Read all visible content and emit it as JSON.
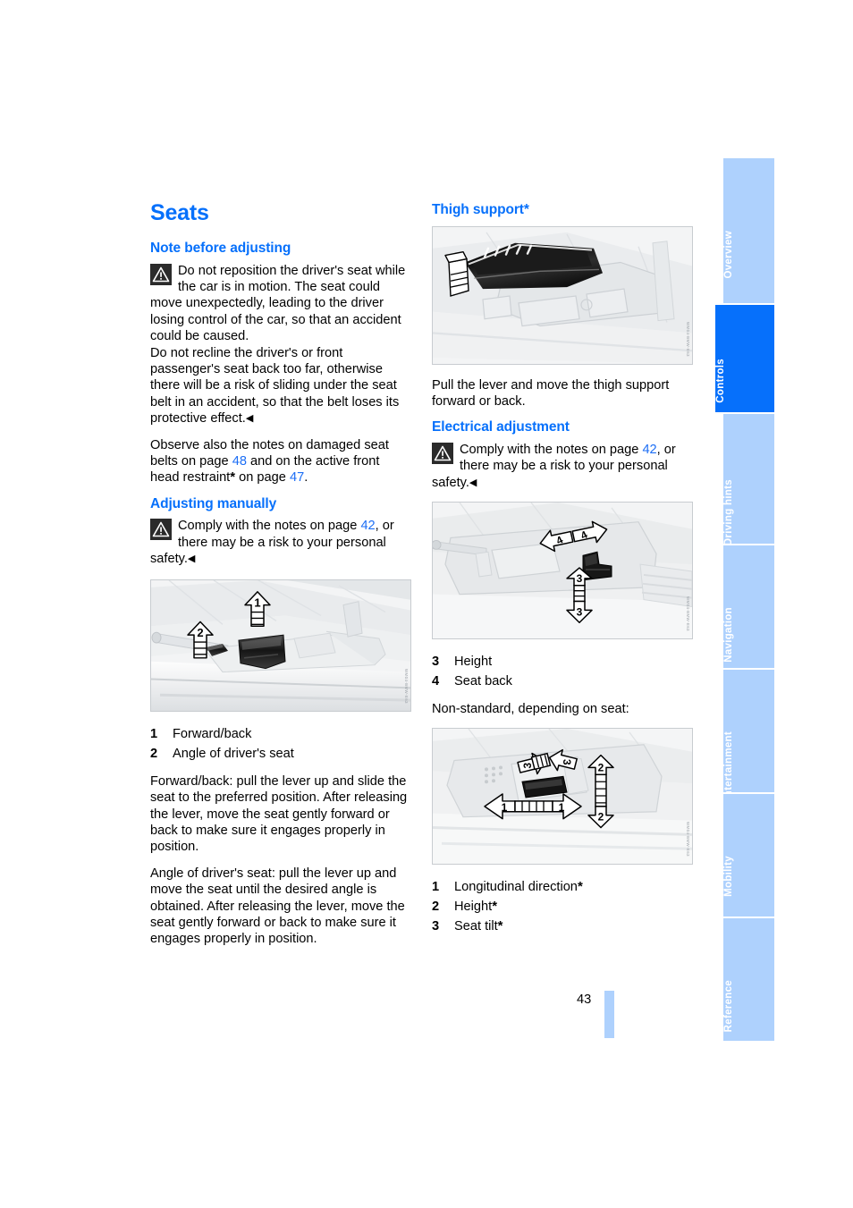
{
  "document": {
    "page_number": "43"
  },
  "left_column": {
    "title": "Seats",
    "section_note": {
      "heading": "Note before adjusting",
      "warning_p1_a": "Do not reposition the driver's seat while the car is in motion. The seat could move unexpectedly, leading to the driver losing control of the car, so that an accident could be caused.",
      "warning_p1_b": "Do not recline the driver's or front passenger's seat back too far, otherwise there will be a risk of sliding under the seat belt in an accident, so that the belt loses its protective effect.",
      "observe_pre": "Observe also the notes on damaged seat belts on page ",
      "observe_ref1": "48",
      "observe_mid": " and on the active front head restraint",
      "observe_mid2": " on page ",
      "observe_ref2": "47",
      "observe_end": "."
    },
    "section_manual": {
      "heading": "Adjusting manually",
      "warning_pre": "Comply with the notes on page ",
      "warning_ref": "42",
      "warning_post": ", or there may be a risk to your personal safety.",
      "legend": [
        {
          "num": "1",
          "label": "Forward/back"
        },
        {
          "num": "2",
          "label": "Angle of driver's seat"
        }
      ],
      "para_forward": "Forward/back: pull the lever up and slide the seat to the preferred position. After releasing the lever, move the seat gently forward or back to make sure it engages properly in position.",
      "para_angle": "Angle of driver's seat: pull the lever up and move the seat until the desired angle is obtained. After releasing the lever, move the seat gently forward or back to make sure it engages properly in position."
    }
  },
  "right_column": {
    "section_thigh": {
      "heading": "Thigh support",
      "heading_asterisk": "*",
      "caption": "Pull the lever and move the thigh support forward or back."
    },
    "section_electrical": {
      "heading": "Electrical adjustment",
      "warning_pre": "Comply with the notes on page ",
      "warning_ref": "42",
      "warning_post": ", or there may be a risk to your personal safety.",
      "legend_primary": [
        {
          "num": "3",
          "label": "Height"
        },
        {
          "num": "4",
          "label": "Seat back"
        }
      ],
      "nonstandard_note": "Non-standard, depending on seat:",
      "legend_secondary": [
        {
          "num": "1",
          "label": "Longitudinal direction",
          "asterisk": "*"
        },
        {
          "num": "2",
          "label": "Height",
          "asterisk": "*"
        },
        {
          "num": "3",
          "label": "Seat tilt",
          "asterisk": "*"
        }
      ]
    }
  },
  "figures": {
    "manual_adjust": {
      "credit": "WM04-BMW-E63",
      "arrow_labels": [
        "1",
        "2"
      ]
    },
    "thigh_support": {
      "credit": "WM04-BMW-E63",
      "arrow_labels": []
    },
    "electrical_adjust": {
      "credit": "WM04-BMW-E63",
      "arrow_labels": [
        "4",
        "4",
        "3",
        "3"
      ]
    },
    "electrical_nonstandard": {
      "credit": "WM04-BMW-E63",
      "arrow_labels": [
        "3",
        "3",
        "2",
        "2",
        "1",
        "1"
      ]
    }
  },
  "sidebar": {
    "tabs": [
      {
        "label": "Overview",
        "active": false
      },
      {
        "label": "Controls",
        "active": true
      },
      {
        "label": "Driving hints",
        "active": false
      },
      {
        "label": "Navigation",
        "active": false
      },
      {
        "label": "Entertainment",
        "active": false
      },
      {
        "label": "Mobility",
        "active": false
      },
      {
        "label": "Reference",
        "active": false
      }
    ]
  },
  "colors": {
    "heading_blue": "#0670fb",
    "link_blue": "#1c6ef5",
    "tab_active": "#0670fb",
    "tab_inactive": "#aed1fd",
    "figure_bg": "#f4f5f6",
    "figure_border": "#c8ccd0"
  }
}
